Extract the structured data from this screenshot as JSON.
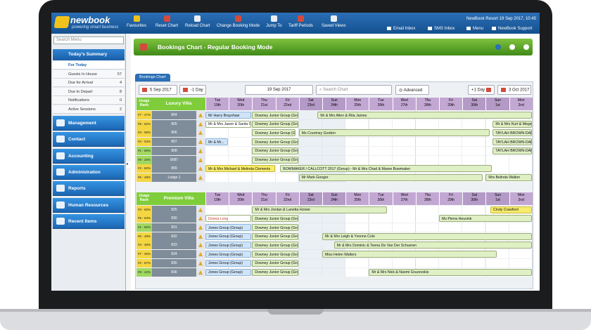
{
  "topbar": {
    "logo": "newbook",
    "tagline": "powering smart business",
    "tools": [
      "Favourites",
      "Reset Chart",
      "Reload Chart",
      "Change Booking Mode",
      "Jump To",
      "Tariff Periods",
      "Saved Views"
    ],
    "resort": "NewBook Resort 19 Sep 2017, 10:45",
    "right": [
      "Email Inbox",
      "SMS Inbox",
      "Menu",
      "NewBook Support"
    ]
  },
  "sidebar": {
    "search_placeholder": "Search Menu",
    "summary": "Today's Summary",
    "items": [
      {
        "label": "For Today",
        "count": ""
      },
      {
        "label": "Guests In House",
        "count": "57"
      },
      {
        "label": "Due for Arrival",
        "count": "4"
      },
      {
        "label": "Due to Depart",
        "count": "8"
      },
      {
        "label": "Notifications",
        "count": "0"
      },
      {
        "label": "Active Sessions",
        "count": "2"
      }
    ],
    "modules": [
      "Management",
      "Contact",
      "Accounting",
      "Administration",
      "Reports",
      "Human Resources",
      "Recent Items"
    ]
  },
  "main": {
    "title": "Bookings Chart - Regular Booking Mode",
    "tab": "Bookings Chart",
    "controls": {
      "prev_date": "5 Sep 2017",
      "minus_day": "-1 Day",
      "current_date": "19 Sep 2017",
      "search_placeholder": "Search Chart",
      "advanced": "Advanced",
      "plus_day": "+1 Day",
      "next_date": "3 Oct 2017"
    },
    "days": [
      [
        "Tue",
        "19th"
      ],
      [
        "Wed",
        "20th"
      ],
      [
        "Thu",
        "21st"
      ],
      [
        "Fri",
        "22nd"
      ],
      [
        "Sat",
        "23rd"
      ],
      [
        "Sun",
        "24th"
      ],
      [
        "Mon",
        "25th"
      ],
      [
        "Tue",
        "26th"
      ],
      [
        "Wed",
        "27th"
      ],
      [
        "Thu",
        "28th"
      ],
      [
        "Fri",
        "29th"
      ],
      [
        "Sat",
        "30th"
      ],
      [
        "Sun",
        "1st"
      ],
      [
        "Mon",
        "2nd"
      ]
    ],
    "groups": [
      {
        "name": "Luxury Villa",
        "rank_label": "Usage Rank",
        "rows": [
          {
            "rank": "#7 - 47%",
            "room": "804",
            "bookings": [
              {
                "t": "Mr Harry Brayshaw",
                "s": 0,
                "e": 2,
                "c": "b"
              },
              {
                "t": "Downey Junior Group (Gro",
                "s": 2,
                "e": 4,
                "c": "g"
              },
              {
                "t": "Mr & Mrs Allen & Rita James",
                "s": 4.8,
                "e": 14,
                "c": "g"
              }
            ]
          },
          {
            "rank": "#5 - 52%",
            "room": "805",
            "bookings": [
              {
                "t": "Mr & Mrs Jason & Sarita Ca",
                "s": 0,
                "e": 2,
                "c": "w"
              },
              {
                "t": "Downey Junior Group (Gro",
                "s": 2,
                "e": 4,
                "c": "g"
              },
              {
                "t": "Mr & Mrs Kurt & Megan Wh",
                "s": 12.3,
                "e": 14,
                "c": "g"
              }
            ]
          },
          {
            "rank": "#3 - 58%",
            "room": "806",
            "bookings": [
              {
                "t": "Downey Junior Group (Gro",
                "s": 2,
                "e": 3.9,
                "c": "g"
              },
              {
                "t": "Ms Courtney Gordon",
                "s": 4,
                "e": 12.2,
                "c": "g"
              },
              {
                "t": "TAYLAH BROWN-DARGAN (",
                "s": 12.3,
                "e": 14,
                "c": "g"
              }
            ]
          },
          {
            "rank": "#4 - 53%",
            "room": "807",
            "bookings": [
              {
                "t": "Mr & Mr...",
                "s": 0,
                "e": 1,
                "c": "b"
              },
              {
                "t": "Downey Junior Group (Gro",
                "s": 2,
                "e": 4,
                "c": "g"
              },
              {
                "t": "TAYLAH BROWN-DARGAN (",
                "s": 12.3,
                "e": 14,
                "c": "g"
              }
            ]
          },
          {
            "rank": "#1 - 60%",
            "room": "808",
            "bookings": [
              {
                "t": "Downey Junior Group (Gro",
                "s": 2,
                "e": 4,
                "c": "g"
              },
              {
                "t": "TAYLAH BROWN-DARGAN (",
                "s": 12.3,
                "e": 14,
                "c": "g"
              }
            ]
          },
          {
            "rank": "#8 - 20%",
            "room": "8087",
            "bookings": [
              {
                "t": "Downey Junior Group (Gro",
                "s": 2,
                "e": 4,
                "c": "g"
              }
            ]
          },
          {
            "rank": "#2 - 60%",
            "room": "809",
            "bookings": [
              {
                "t": "Mr & Mrs Michael & Melinda Clements",
                "s": 0,
                "e": 3,
                "c": "y"
              },
              {
                "t": "BOWMAKER / CALLCOTT 2017 (Group) - Mr & Mrs Chad & Maree Bowmaker",
                "s": 3.2,
                "e": 12.3,
                "c": "g"
              }
            ]
          },
          {
            "rank": "#6 - 49%",
            "room": "Lodge 1",
            "bookings": [
              {
                "t": "Mr Mark Googer",
                "s": 4,
                "e": 11.9,
                "c": "g"
              },
              {
                "t": "Mrs Belinda Walton",
                "s": 12,
                "e": 14,
                "c": "g"
              }
            ]
          }
        ]
      },
      {
        "name": "Premium Villa",
        "rank_label": "Usage Rank",
        "rows": [
          {
            "rank": "#3 - 60%",
            "room": "825",
            "bookings": [
              {
                "t": "Mr & Mrs Jordan & Lanetta Honier",
                "s": 2,
                "e": 7.8,
                "c": "g"
              },
              {
                "t": "Cindy Crawford",
                "s": 12.2,
                "e": 14,
                "c": "y"
              }
            ]
          },
          {
            "rank": "#5 - 54%",
            "room": "830",
            "bookings": [
              {
                "t": "Donna Long",
                "s": 0,
                "e": 2,
                "c": "w",
                "red": true
              },
              {
                "t": "Downey Junior Group (Gro",
                "s": 2,
                "e": 4,
                "c": "g"
              },
              {
                "t": "Ms Pierra Heuvink",
                "s": 10,
                "e": 14,
                "c": "g"
              }
            ]
          },
          {
            "rank": "#1 - 60%",
            "room": "831",
            "bookings": [
              {
                "t": "Jones Group (Group)",
                "s": 0,
                "e": 2,
                "c": "b"
              },
              {
                "t": "Downey Junior Group (Gro",
                "s": 2,
                "e": 4,
                "c": "g"
              }
            ]
          },
          {
            "rank": "#6 - 49%",
            "room": "832",
            "bookings": [
              {
                "t": "Jones Group (Group)",
                "s": 0,
                "e": 2,
                "c": "b"
              },
              {
                "t": "Downey Junior Group (Gro",
                "s": 2,
                "e": 4,
                "c": "g"
              },
              {
                "t": "Mr & Mrs Leigh & Yvonne Cole",
                "s": 5,
                "e": 14,
                "c": "g"
              }
            ]
          },
          {
            "rank": "#4 - 49%",
            "room": "833",
            "bookings": [
              {
                "t": "Jones Group (Group)",
                "s": 0,
                "e": 2,
                "c": "b"
              },
              {
                "t": "Downey Junior Group (Gro",
                "s": 2,
                "e": 4,
                "c": "g"
              },
              {
                "t": "Mr & Mrs Dominic & Teena De Van Der Schueren",
                "s": 5.5,
                "e": 14,
                "c": "g"
              }
            ]
          },
          {
            "rank": "#7 - 45%",
            "room": "834",
            "bookings": [
              {
                "t": "Jones Group (Group)",
                "s": 0,
                "e": 2,
                "c": "b"
              },
              {
                "t": "Downey Junior Group (Gro",
                "s": 2,
                "e": 4,
                "c": "g"
              },
              {
                "t": "Miss Helen Walters",
                "s": 5,
                "e": 12.5,
                "c": "g"
              }
            ]
          },
          {
            "rank": "#2 - 67%",
            "room": "835",
            "bookings": [
              {
                "t": "Jones Group (Group)",
                "s": 0,
                "e": 2,
                "c": "b"
              },
              {
                "t": "Downey Junior Group (Gro",
                "s": 2,
                "e": 4,
                "c": "g"
              }
            ]
          },
          {
            "rank": "#8 - 42%",
            "room": "836",
            "bookings": [
              {
                "t": "Jones Group (Group)",
                "s": 0,
                "e": 2,
                "c": "b"
              },
              {
                "t": "Downey Junior Group (Gro",
                "s": 2,
                "e": 4,
                "c": "g"
              },
              {
                "t": "Mr & Mrs Nick & Naomi Gruzevskis",
                "s": 7,
                "e": 14,
                "c": "g"
              }
            ]
          }
        ]
      }
    ]
  }
}
